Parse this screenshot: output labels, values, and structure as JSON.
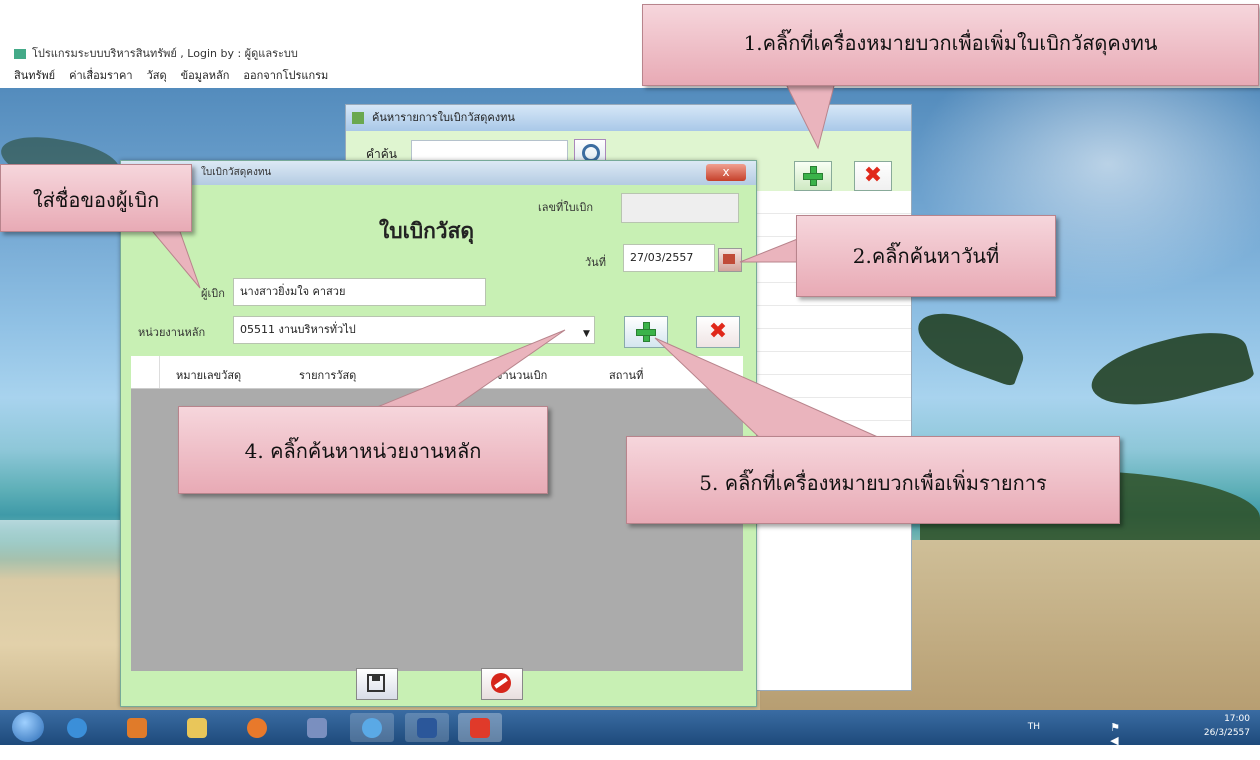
{
  "app": {
    "title": "โปรแกรมระบบบริหารสินทรัพย์ , Login by : ผู้ดูแลระบบ",
    "menu": [
      "สินทรัพย์",
      "ค่าเสื่อมราคา",
      "วัสดุ",
      "ข้อมูลหลัก",
      "ออกจากโปรแกรม"
    ]
  },
  "back_window": {
    "title": "ค้นหารายการใบเบิกวัสดุคงทน",
    "search_label": "คำค้น",
    "search_value": ""
  },
  "dialog": {
    "title": "ใบเบิกวัสดุคงทน",
    "close_label": "x",
    "form_title": "ใบเบิกวัสดุ",
    "doc_no_label": "เลขที่ใบเบิก",
    "doc_no_value": "",
    "date_label": "วันที่",
    "date_value": "27/03/2557",
    "requester_label": "ผู้เบิก",
    "requester_value": "นางสาวยิ่งมใจ คาสวย",
    "unit_label": "หน่วยงานหลัก",
    "unit_value": "05511 งานบริหารทั่วไป",
    "columns": [
      "หมายเลขวัสดุ",
      "รายการวัสดุ",
      "จำนวนเบิก",
      "สถานที่"
    ]
  },
  "callouts": {
    "c1": "1.คลิ๊กที่เครื่องหมายบวกเพื่อเพิ่มใบเบิกวัสดุคงทน",
    "c2": "2.คลิ๊กค้นหาวันที่",
    "c3": "ใส่ชื่อของผู้เบิก",
    "c4": "4. คลิ๊กค้นหาหน่วยงานหลัก",
    "c5": "5. คลิ๊กที่เครื่องหมายบวกเพื่อเพิ่มรายการ"
  },
  "taskbar": {
    "lang": "TH",
    "time": "17:00",
    "date": "26/3/2557"
  },
  "colors": {
    "dialog_bg": "#c8f0b4",
    "callout": "#f0c4cc",
    "taskbar": "#2a5a8f"
  }
}
